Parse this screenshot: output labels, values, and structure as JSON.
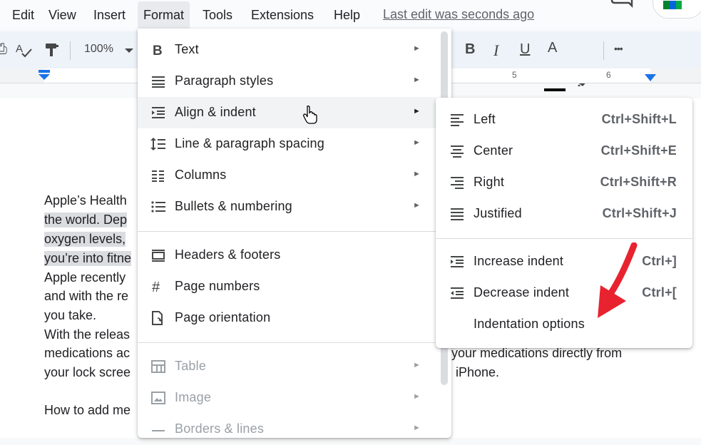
{
  "menubar": {
    "items": [
      "Edit",
      "View",
      "Insert",
      "Format",
      "Tools",
      "Extensions",
      "Help"
    ],
    "last_edit": "Last edit was seconds ago"
  },
  "toolbar": {
    "zoom": "100%",
    "bold": "B",
    "italic": "I",
    "underline": "U",
    "text_color_letter": "A",
    "more": "•••"
  },
  "ruler": {
    "marks": [
      "5",
      "6"
    ]
  },
  "document": {
    "lines": [
      "Apple’s Health",
      "the world. Dep",
      "oxygen levels,",
      "you’re into fitne",
      "Apple recently",
      "and with the re",
      "you take.",
      "With the releas",
      "medications ac",
      "your lock scree",
      "How to add me"
    ],
    "right_lines": [
      "your medications directly from",
      "iPhone."
    ]
  },
  "format_menu": {
    "items": [
      {
        "label": "Text",
        "icon": "bold-icon"
      },
      {
        "label": "Paragraph styles",
        "icon": "paragraph-styles-icon"
      },
      {
        "label": "Align & indent",
        "icon": "align-indent-icon"
      },
      {
        "label": "Line & paragraph spacing",
        "icon": "line-spacing-icon"
      },
      {
        "label": "Columns",
        "icon": "columns-icon"
      },
      {
        "label": "Bullets & numbering",
        "icon": "bullets-icon"
      },
      {
        "label": "Headers & footers",
        "icon": "headers-footers-icon"
      },
      {
        "label": "Page numbers",
        "icon": "hash-icon"
      },
      {
        "label": "Page orientation",
        "icon": "page-orientation-icon"
      },
      {
        "label": "Table",
        "icon": "table-icon"
      },
      {
        "label": "Image",
        "icon": "image-icon"
      },
      {
        "label": "Borders & lines",
        "icon": "borders-lines-icon"
      }
    ]
  },
  "submenu": {
    "items": [
      {
        "label": "Left",
        "shortcut": "Ctrl+Shift+L"
      },
      {
        "label": "Center",
        "shortcut": "Ctrl+Shift+E"
      },
      {
        "label": "Right",
        "shortcut": "Ctrl+Shift+R"
      },
      {
        "label": "Justified",
        "shortcut": "Ctrl+Shift+J"
      },
      {
        "label": "Increase indent",
        "shortcut": "Ctrl+]"
      },
      {
        "label": "Decrease indent",
        "shortcut": "Ctrl+["
      },
      {
        "label": "Indentation options",
        "shortcut": ""
      }
    ]
  },
  "colors": {
    "accent_blue": "#1a73e8",
    "highlight": "#dadce0",
    "annotation_red": "#e8232f"
  }
}
